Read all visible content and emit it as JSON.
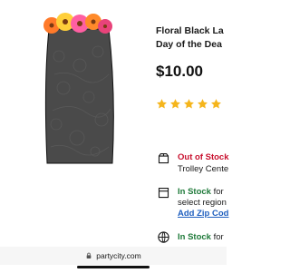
{
  "product": {
    "title_line1": "Floral Black La",
    "title_line2": "Day of the Dea",
    "price": "$10.00",
    "rating_stars": 5,
    "image_icon": "floral-veil-image"
  },
  "fulfillment": {
    "shipping": {
      "status": "Out of Stock",
      "detail": "Trolley Cente",
      "icon": "box-icon"
    },
    "pickup": {
      "status": "In Stock",
      "status_suffix": " for",
      "detail": "select region",
      "link": "Add Zip Cod",
      "icon": "store-icon"
    },
    "same_day": {
      "status": "In Stock",
      "status_suffix": " for",
      "icon": "globe-icon"
    }
  },
  "browser": {
    "url": "partycity.com",
    "lock_icon": "lock-icon"
  },
  "colors": {
    "star": "#f5b51c",
    "out_of_stock": "#c8102e",
    "in_stock": "#1f7a3a",
    "link": "#1f5fbf"
  }
}
